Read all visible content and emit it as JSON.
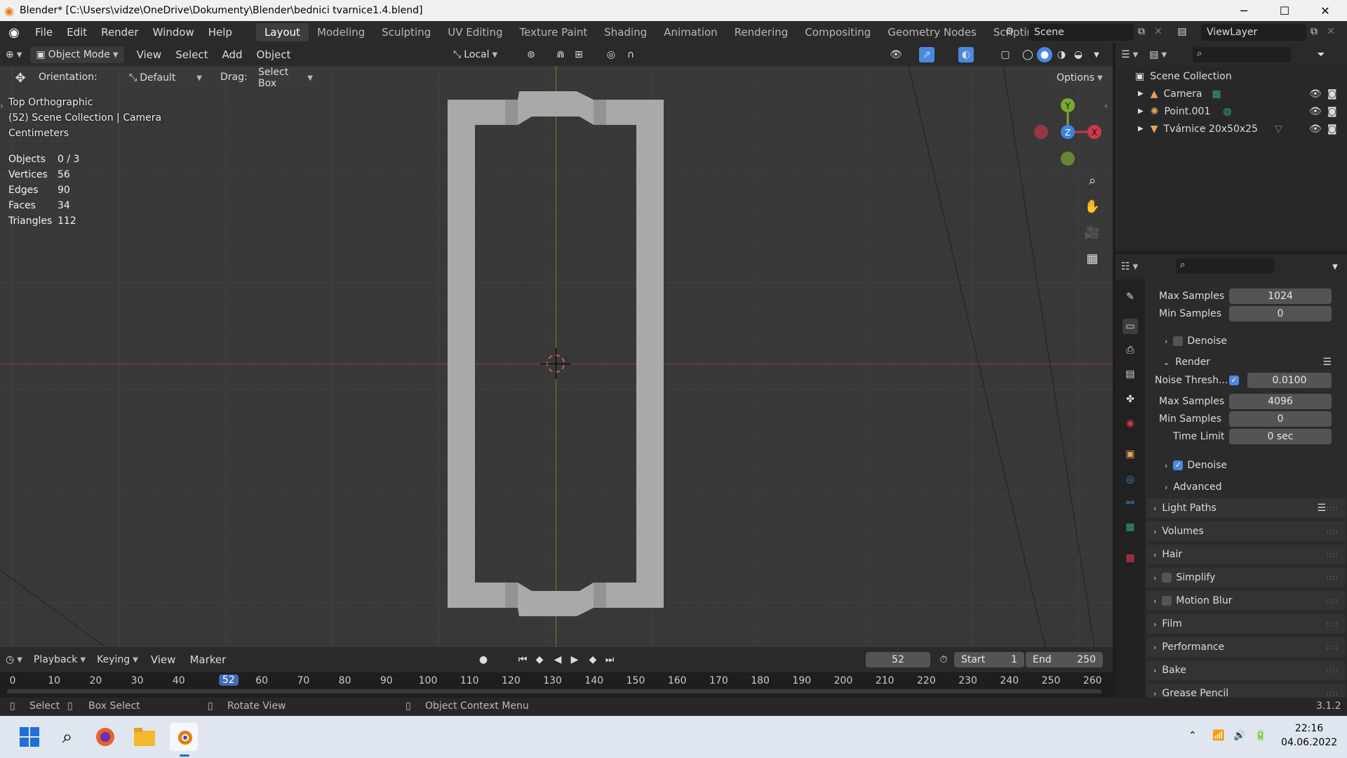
{
  "window": {
    "title": "Blender* [C:\\Users\\vidze\\OneDrive\\Dokumenty\\Blender\\bednici tvarnice1.4.blend]",
    "minimize": "─",
    "maximize": "☐",
    "close": "✕"
  },
  "menu": [
    "File",
    "Edit",
    "Render",
    "Window",
    "Help"
  ],
  "workspaces": [
    "Layout",
    "Modeling",
    "Sculpting",
    "UV Editing",
    "Texture Paint",
    "Shading",
    "Animation",
    "Rendering",
    "Compositing",
    "Geometry Nodes",
    "Scripting"
  ],
  "workspace_add": "+",
  "scene": {
    "name": "Scene",
    "view_layer": "ViewLayer"
  },
  "viewport_header": {
    "mode": "Object Mode",
    "menus": [
      "View",
      "Select",
      "Add",
      "Object"
    ],
    "pivot": "Local"
  },
  "tool_header": {
    "orientation_label": "Orientation:",
    "orientation_value": "Default",
    "drag_label": "Drag:",
    "drag_value": "Select Box",
    "options": "Options"
  },
  "overlay": {
    "view_name": "Top Orthographic",
    "collection_info": "(52) Scene Collection | Camera",
    "units": "Centimeters",
    "stats": [
      {
        "label": "Objects",
        "value": "0 / 3"
      },
      {
        "label": "Vertices",
        "value": "56"
      },
      {
        "label": "Edges",
        "value": "90"
      },
      {
        "label": "Faces",
        "value": "34"
      },
      {
        "label": "Triangles",
        "value": "112"
      }
    ]
  },
  "gizmo": {
    "x": "X",
    "y": "Y",
    "z": "Z"
  },
  "timeline": {
    "menus": [
      "Playback",
      "Keying",
      "View",
      "Marker"
    ],
    "current_frame": "52",
    "start_label": "Start",
    "start_value": "1",
    "end_label": "End",
    "end_value": "250",
    "ticks": [
      "0",
      "10",
      "20",
      "30",
      "40",
      "52",
      "60",
      "70",
      "80",
      "90",
      "100",
      "110",
      "120",
      "130",
      "140",
      "150",
      "160",
      "170",
      "180",
      "190",
      "200",
      "210",
      "220",
      "230",
      "240",
      "250",
      "260"
    ]
  },
  "statusbar": {
    "select": "Select",
    "box_select": "Box Select",
    "rotate_view": "Rotate View",
    "context_menu": "Object Context Menu",
    "version": "3.1.2"
  },
  "outliner": {
    "root": "Scene Collection",
    "items": [
      {
        "name": "Camera"
      },
      {
        "name": "Point.001"
      },
      {
        "name": "Tvárnice 20x50x25"
      }
    ]
  },
  "properties": {
    "viewport_max_samples_label": "Max Samples",
    "viewport_max_samples": "1024",
    "viewport_min_samples_label": "Min Samples",
    "viewport_min_samples": "0",
    "viewport_denoise": "Denoise",
    "render_panel": "Render",
    "noise_threshold_label": "Noise Thresh...",
    "noise_threshold": "0.0100",
    "render_max_samples_label": "Max Samples",
    "render_max_samples": "4096",
    "render_min_samples_label": "Min Samples",
    "render_min_samples": "0",
    "time_limit_label": "Time Limit",
    "time_limit": "0 sec",
    "render_denoise": "Denoise",
    "advanced": "Advanced",
    "panels": [
      "Light Paths",
      "Volumes",
      "Hair",
      "Simplify",
      "Motion Blur",
      "Film",
      "Performance",
      "Bake",
      "Grease Pencil"
    ]
  },
  "taskbar": {
    "time": "22:16",
    "date": "04.06.2022"
  },
  "colors": {
    "accent": "#4a89dc",
    "active_frame": "#3e6bb5",
    "x_axis": "#d0384a",
    "y_axis": "#7ba82f",
    "z_axis": "#3f82e0"
  }
}
